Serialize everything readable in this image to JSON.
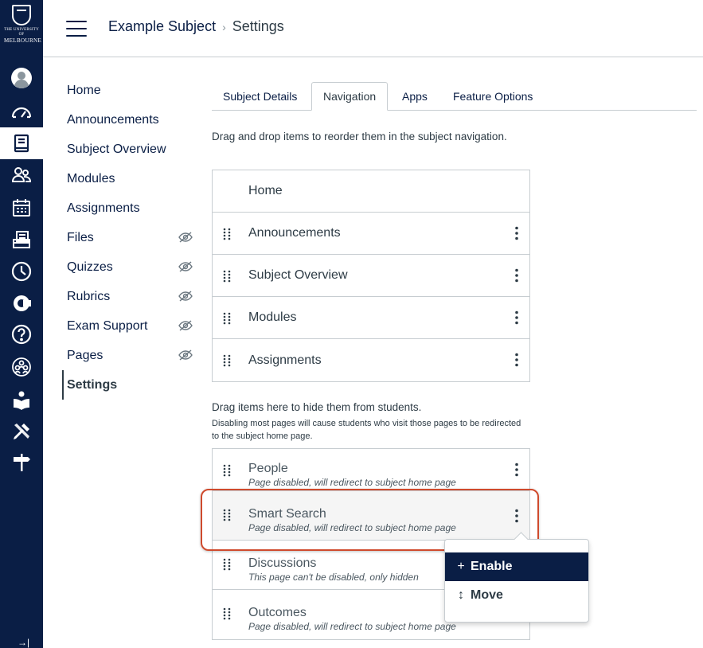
{
  "logo": {
    "line1": "THE UNIVERSITY OF",
    "line2": "MELBOURNE"
  },
  "rail": [
    {
      "name": "account-icon"
    },
    {
      "name": "dashboard-icon"
    },
    {
      "name": "subjects-icon",
      "active": true
    },
    {
      "name": "groups-icon"
    },
    {
      "name": "calendar-icon"
    },
    {
      "name": "inbox-icon"
    },
    {
      "name": "history-icon"
    },
    {
      "name": "commons-icon"
    },
    {
      "name": "help-icon"
    },
    {
      "name": "community-icon"
    },
    {
      "name": "library-icon"
    },
    {
      "name": "tools-icon"
    },
    {
      "name": "signpost-icon"
    }
  ],
  "breadcrumb": {
    "subject": "Example Subject",
    "separator": "›",
    "current": "Settings"
  },
  "course_nav": [
    {
      "label": "Home",
      "hidden": false
    },
    {
      "label": "Announcements",
      "hidden": false
    },
    {
      "label": "Subject Overview",
      "hidden": false
    },
    {
      "label": "Modules",
      "hidden": false
    },
    {
      "label": "Assignments",
      "hidden": false
    },
    {
      "label": "Files",
      "hidden": true
    },
    {
      "label": "Quizzes",
      "hidden": true
    },
    {
      "label": "Rubrics",
      "hidden": true
    },
    {
      "label": "Exam Support",
      "hidden": true
    },
    {
      "label": "Pages",
      "hidden": true
    },
    {
      "label": "Settings",
      "active": true
    }
  ],
  "tabs": [
    {
      "label": "Subject Details"
    },
    {
      "label": "Navigation",
      "active": true
    },
    {
      "label": "Apps"
    },
    {
      "label": "Feature Options"
    }
  ],
  "intro": "Drag and drop items to reorder them in the subject navigation.",
  "enabled_items": [
    "Home",
    "Announcements",
    "Subject Overview",
    "Modules",
    "Assignments"
  ],
  "hidden_title": "Drag items here to hide them from students.",
  "hidden_note": "Disabling most pages will cause students who visit those pages to be redirected to the subject home page.",
  "hidden_items": [
    {
      "label": "People",
      "sub": "Page disabled, will redirect to subject home page"
    },
    {
      "label": "Smart Search",
      "sub": "Page disabled, will redirect to subject home page"
    },
    {
      "label": "Discussions",
      "sub": "This page can't be disabled, only hidden"
    },
    {
      "label": "Outcomes",
      "sub": "Page disabled, will redirect to subject home page"
    }
  ],
  "menu": {
    "enable": "Enable",
    "move": "Move",
    "enable_icon": "+",
    "move_icon": "↕"
  },
  "colors": {
    "navy": "#0a1e45",
    "callout": "#cf4a2d",
    "border": "#c7cdd1"
  }
}
